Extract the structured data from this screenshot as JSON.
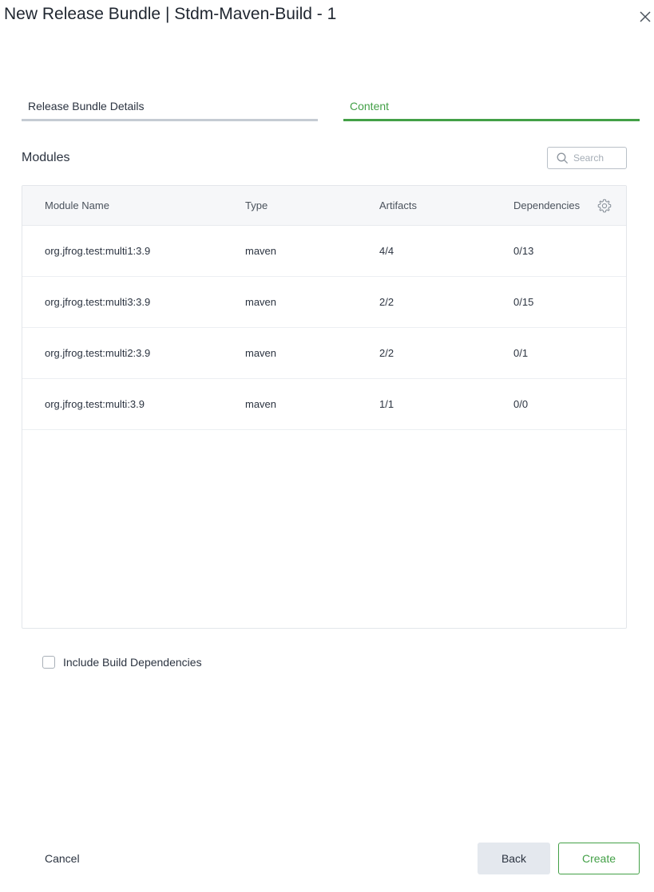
{
  "dialog": {
    "title": "New Release Bundle | Stdm-Maven-Build - 1",
    "close_icon": "close-icon"
  },
  "steps": [
    {
      "label": "Release Bundle Details",
      "active": false
    },
    {
      "label": "Content",
      "active": true
    }
  ],
  "modules": {
    "title": "Modules",
    "search": {
      "placeholder": "Search",
      "value": "",
      "icon": "search-icon"
    },
    "settings_icon": "gear-icon",
    "columns": [
      "Module Name",
      "Type",
      "Artifacts",
      "Dependencies"
    ],
    "rows": [
      {
        "name": "org.jfrog.test:multi1:3.9",
        "type": "maven",
        "artifacts": "4/4",
        "dependencies": "0/13"
      },
      {
        "name": "org.jfrog.test:multi3:3.9",
        "type": "maven",
        "artifacts": "2/2",
        "dependencies": "0/15"
      },
      {
        "name": "org.jfrog.test:multi2:3.9",
        "type": "maven",
        "artifacts": "2/2",
        "dependencies": "0/1"
      },
      {
        "name": "org.jfrog.test:multi:3.9",
        "type": "maven",
        "artifacts": "1/1",
        "dependencies": "0/0"
      }
    ]
  },
  "include_build_dependencies": {
    "label": "Include Build Dependencies",
    "checked": false
  },
  "footer": {
    "cancel_label": "Cancel",
    "back_label": "Back",
    "create_label": "Create"
  },
  "colors": {
    "accent": "#43a047",
    "inactive_step": "#c5cbd3",
    "back_button_bg": "#e4e8ee"
  }
}
